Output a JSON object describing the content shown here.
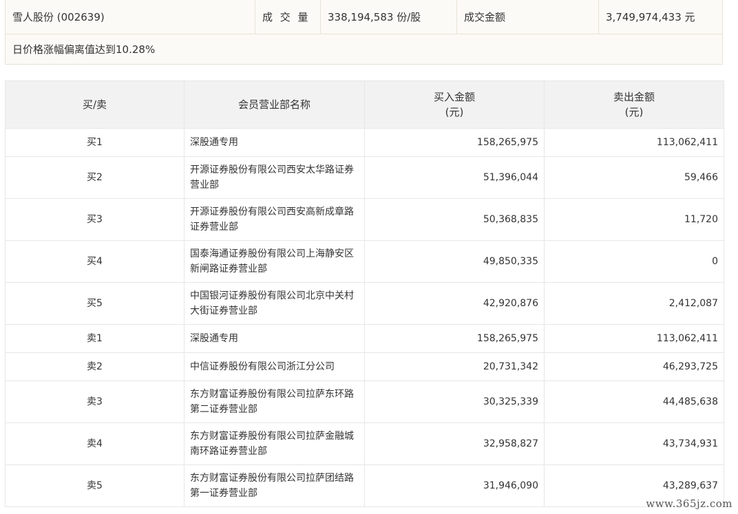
{
  "summary": {
    "stock": "雪人股份 (002639)",
    "volume_label": "成 交 量",
    "volume_value": "338,194,583 份/股",
    "amount_label": "成交金额",
    "amount_value": "3,749,974,433 元",
    "note": "日价格涨幅偏离值达到10.28%"
  },
  "table": {
    "headers": {
      "side": "买/卖",
      "name": "会员营业部名称",
      "buy_line1": "买入金额",
      "buy_line2": "(元)",
      "sell_line1": "卖出金额",
      "sell_line2": "(元)"
    },
    "rows": [
      {
        "side": "买1",
        "name": "深股通专用",
        "buy": "158,265,975",
        "sell": "113,062,411"
      },
      {
        "side": "买2",
        "name": "开源证券股份有限公司西安太华路证券营业部",
        "buy": "51,396,044",
        "sell": "59,466"
      },
      {
        "side": "买3",
        "name": "开源证券股份有限公司西安高新成章路证券营业部",
        "buy": "50,368,835",
        "sell": "11,720"
      },
      {
        "side": "买4",
        "name": "国泰海通证券股份有限公司上海静安区新闸路证券营业部",
        "buy": "49,850,335",
        "sell": "0"
      },
      {
        "side": "买5",
        "name": "中国银河证券股份有限公司北京中关村大街证券营业部",
        "buy": "42,920,876",
        "sell": "2,412,087"
      },
      {
        "side": "卖1",
        "name": "深股通专用",
        "buy": "158,265,975",
        "sell": "113,062,411"
      },
      {
        "side": "卖2",
        "name": "中信证券股份有限公司浙江分公司",
        "buy": "20,731,342",
        "sell": "46,293,725"
      },
      {
        "side": "卖3",
        "name": "东方财富证券股份有限公司拉萨东环路第二证券营业部",
        "buy": "30,325,339",
        "sell": "44,485,638"
      },
      {
        "side": "卖4",
        "name": "东方财富证券股份有限公司拉萨金融城南环路证券营业部",
        "buy": "32,958,827",
        "sell": "43,734,931"
      },
      {
        "side": "卖5",
        "name": "东方财富证券股份有限公司拉萨团结路第一证券营业部",
        "buy": "31,946,090",
        "sell": "43,289,637"
      }
    ]
  },
  "watermark": "www.365jz.com"
}
